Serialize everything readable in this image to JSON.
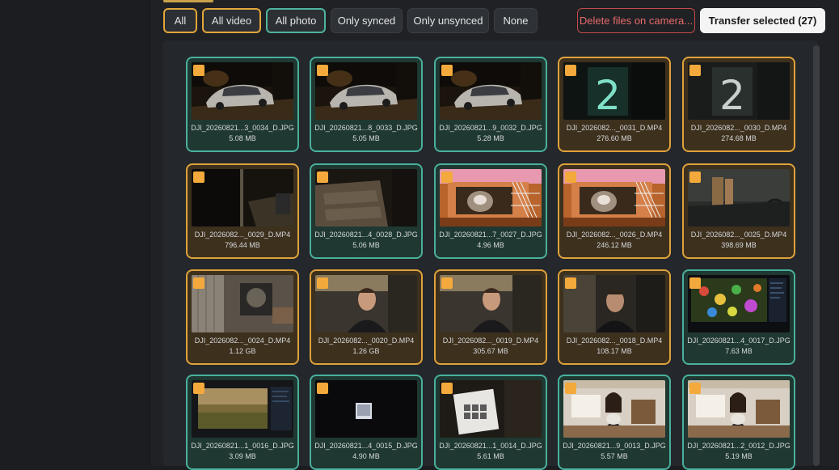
{
  "filters": {
    "all": "All",
    "all_video": "All video",
    "all_photo": "All photo",
    "only_synced": "Only synced",
    "only_unsynced": "Only unsynced",
    "none": "None"
  },
  "actions": {
    "delete": "Delete files on camera...",
    "transfer": "Transfer selected (27)"
  },
  "colors": {
    "photo_border": "#49b09d",
    "video_border": "#dfa23b",
    "checkbox": "#f3a93b",
    "danger": "#c44a4a"
  },
  "files": [
    {
      "name": "DJI_20260821...3_0034_D.JPG",
      "size": "5.08 MB",
      "kind": "photo",
      "scene": "car-night"
    },
    {
      "name": "DJI_20260821...8_0033_D.JPG",
      "size": "5.05 MB",
      "kind": "photo",
      "scene": "car-night"
    },
    {
      "name": "DJI_20260821...9_0032_D.JPG",
      "size": "5.28 MB",
      "kind": "photo",
      "scene": "car-night"
    },
    {
      "name": "DJI_2026082..._0031_D.MP4",
      "size": "276.60 MB",
      "kind": "video",
      "scene": "house-number"
    },
    {
      "name": "DJI_2026082..._0030_D.MP4",
      "size": "274.68 MB",
      "kind": "video",
      "scene": "house-number-dim"
    },
    {
      "name": "DJI_2026082..._0029_D.MP4",
      "size": "796.44 MB",
      "kind": "video",
      "scene": "porch-night"
    },
    {
      "name": "DJI_20260821...4_0028_D.JPG",
      "size": "5.06 MB",
      "kind": "photo",
      "scene": "steps"
    },
    {
      "name": "DJI_20260821...7_0027_D.JPG",
      "size": "4.96 MB",
      "kind": "photo",
      "scene": "cat-crate"
    },
    {
      "name": "DJI_2026082..._0026_D.MP4",
      "size": "246.12 MB",
      "kind": "video",
      "scene": "cat-crate"
    },
    {
      "name": "DJI_2026082..._0025_D.MP4",
      "size": "398.69 MB",
      "kind": "video",
      "scene": "garage"
    },
    {
      "name": "DJI_2026082..._0024_D.MP4",
      "size": "1.12 GB",
      "kind": "video",
      "scene": "room"
    },
    {
      "name": "DJI_2026082..._0020_D.MP4",
      "size": "1.26 GB",
      "kind": "video",
      "scene": "man"
    },
    {
      "name": "DJI_2026082..._0019_D.MP4",
      "size": "305.67 MB",
      "kind": "video",
      "scene": "man"
    },
    {
      "name": "DJI_2026082..._0018_D.MP4",
      "size": "108.17 MB",
      "kind": "video",
      "scene": "man-dark"
    },
    {
      "name": "DJI_20260821...4_0017_D.JPG",
      "size": "7.63 MB",
      "kind": "photo",
      "scene": "monitor-colorful"
    },
    {
      "name": "DJI_20260821...1_0016_D.JPG",
      "size": "3.09 MB",
      "kind": "photo",
      "scene": "monitor-landscape"
    },
    {
      "name": "DJI_20260821...4_0015_D.JPG",
      "size": "4.90 MB",
      "kind": "photo",
      "scene": "dark-screen"
    },
    {
      "name": "DJI_20260821...1_0014_D.JPG",
      "size": "5.61 MB",
      "kind": "photo",
      "scene": "box"
    },
    {
      "name": "DJI_20260821...9_0013_D.JPG",
      "size": "5.57 MB",
      "kind": "photo",
      "scene": "woman-cat"
    },
    {
      "name": "DJI_20260821...2_0012_D.JPG",
      "size": "5.19 MB",
      "kind": "photo",
      "scene": "woman-cat"
    }
  ]
}
